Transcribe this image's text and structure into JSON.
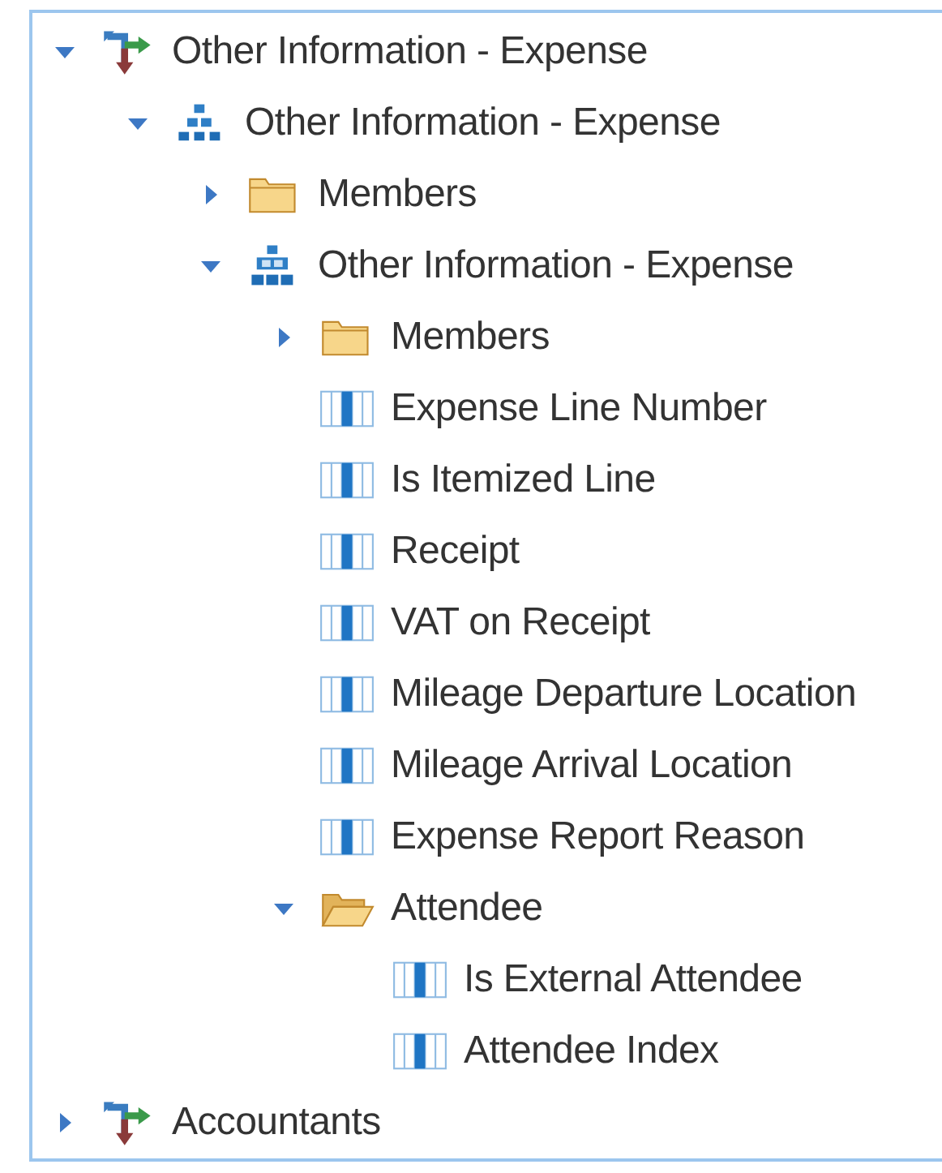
{
  "tree": [
    {
      "kind": "dimension",
      "label": "Other Information - Expense",
      "expanded": true,
      "children": [
        {
          "kind": "hierarchy",
          "label": "Other Information - Expense",
          "expanded": true,
          "children": [
            {
              "kind": "folder",
              "label": "Members",
              "expanded": false
            },
            {
              "kind": "level",
              "label": "Other Information - Expense",
              "expanded": true,
              "children": [
                {
                  "kind": "folder",
                  "label": "Members",
                  "expanded": false
                },
                {
                  "kind": "attribute",
                  "label": "Expense Line Number"
                },
                {
                  "kind": "attribute",
                  "label": "Is Itemized Line"
                },
                {
                  "kind": "attribute",
                  "label": "Receipt"
                },
                {
                  "kind": "attribute",
                  "label": "VAT on Receipt"
                },
                {
                  "kind": "attribute",
                  "label": "Mileage Departure Location"
                },
                {
                  "kind": "attribute",
                  "label": "Mileage Arrival Location"
                },
                {
                  "kind": "attribute",
                  "label": "Expense Report Reason"
                },
                {
                  "kind": "folder",
                  "label": "Attendee",
                  "expanded": true,
                  "children": [
                    {
                      "kind": "attribute",
                      "label": "Is External Attendee"
                    },
                    {
                      "kind": "attribute",
                      "label": "Attendee Index"
                    }
                  ]
                }
              ]
            }
          ]
        }
      ]
    },
    {
      "kind": "dimension",
      "label": "Accountants",
      "expanded": false
    }
  ]
}
